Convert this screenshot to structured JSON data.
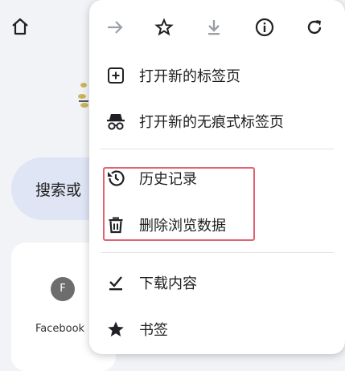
{
  "background": {
    "search_placeholder": "搜索或",
    "tile_avatar_letter": "F",
    "tile_label": "Facebook"
  },
  "menu": {
    "toolbar": {
      "forward": "forward-icon",
      "bookmark": "star-icon",
      "download": "download-icon",
      "info": "info-icon",
      "reload": "reload-icon"
    },
    "items": [
      {
        "label": "打开新的标签页",
        "icon": "new-tab-icon"
      },
      {
        "label": "打开新的无痕式标签页",
        "icon": "incognito-icon"
      },
      {
        "label": "历史记录",
        "icon": "history-icon"
      },
      {
        "label": "删除浏览数据",
        "icon": "trash-icon"
      },
      {
        "label": "下载内容",
        "icon": "downloads-icon"
      },
      {
        "label": "书签",
        "icon": "star-filled-icon"
      }
    ],
    "highlight_color": "#e06372"
  }
}
